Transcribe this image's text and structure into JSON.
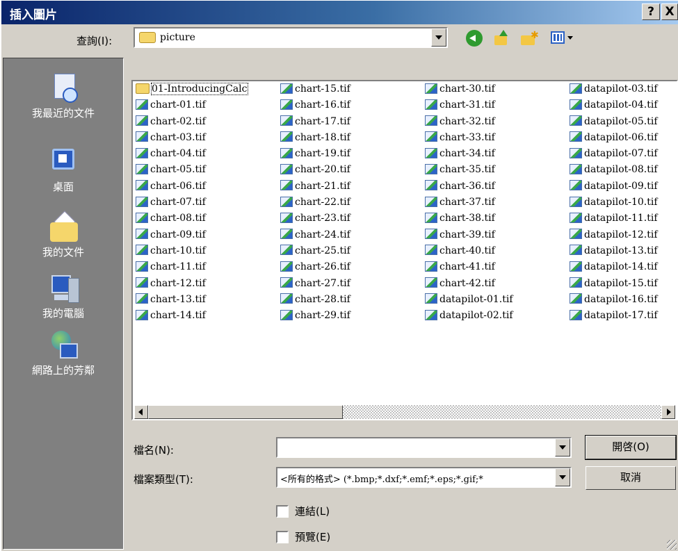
{
  "window": {
    "title": "插入圖片",
    "help_label": "?",
    "close_label": "X"
  },
  "toolbar": {
    "lookin_label": "查詢(I):",
    "lookin_value": "picture",
    "icons": [
      "back-icon",
      "up-folder-icon",
      "new-folder-icon",
      "views-menu-icon"
    ]
  },
  "places": [
    {
      "label": "我最近的文件",
      "icon": "recent-documents-icon"
    },
    {
      "label": "桌面",
      "icon": "desktop-icon"
    },
    {
      "label": "我的文件",
      "icon": "my-documents-icon"
    },
    {
      "label": "我的電腦",
      "icon": "my-computer-icon"
    },
    {
      "label": "網路上的芳鄰",
      "icon": "network-places-icon"
    }
  ],
  "files": {
    "columns": [
      [
        "01-IntroducingCalc",
        "chart-01.tif",
        "chart-02.tif",
        "chart-03.tif",
        "chart-04.tif",
        "chart-05.tif",
        "chart-06.tif",
        "chart-07.tif",
        "chart-08.tif",
        "chart-09.tif",
        "chart-10.tif",
        "chart-11.tif",
        "chart-12.tif",
        "chart-13.tif",
        "chart-14.tif"
      ],
      [
        "chart-15.tif",
        "chart-16.tif",
        "chart-17.tif",
        "chart-18.tif",
        "chart-19.tif",
        "chart-20.tif",
        "chart-21.tif",
        "chart-22.tif",
        "chart-23.tif",
        "chart-24.tif",
        "chart-25.tif",
        "chart-26.tif",
        "chart-27.tif",
        "chart-28.tif",
        "chart-29.tif"
      ],
      [
        "chart-30.tif",
        "chart-31.tif",
        "chart-32.tif",
        "chart-33.tif",
        "chart-34.tif",
        "chart-35.tif",
        "chart-36.tif",
        "chart-37.tif",
        "chart-38.tif",
        "chart-39.tif",
        "chart-40.tif",
        "chart-41.tif",
        "chart-42.tif",
        "datapilot-01.tif",
        "datapilot-02.tif"
      ],
      [
        "datapilot-03.tif",
        "datapilot-04.tif",
        "datapilot-05.tif",
        "datapilot-06.tif",
        "datapilot-07.tif",
        "datapilot-08.tif",
        "datapilot-09.tif",
        "datapilot-10.tif",
        "datapilot-11.tif",
        "datapilot-12.tif",
        "datapilot-13.tif",
        "datapilot-14.tif",
        "datapilot-15.tif",
        "datapilot-16.tif",
        "datapilot-17.tif"
      ]
    ]
  },
  "form": {
    "filename_label": "檔名(N):",
    "filename_value": "",
    "filetype_label": "檔案類型(T):",
    "filetype_value": "<所有的格式> (*.bmp;*.dxf;*.emf;*.eps;*.gif;*",
    "open_label": "開啓(O)",
    "cancel_label": "取消",
    "link_label": "連結(L)",
    "link_checked": false,
    "preview_label": "預覽(E)",
    "preview_checked": false
  }
}
